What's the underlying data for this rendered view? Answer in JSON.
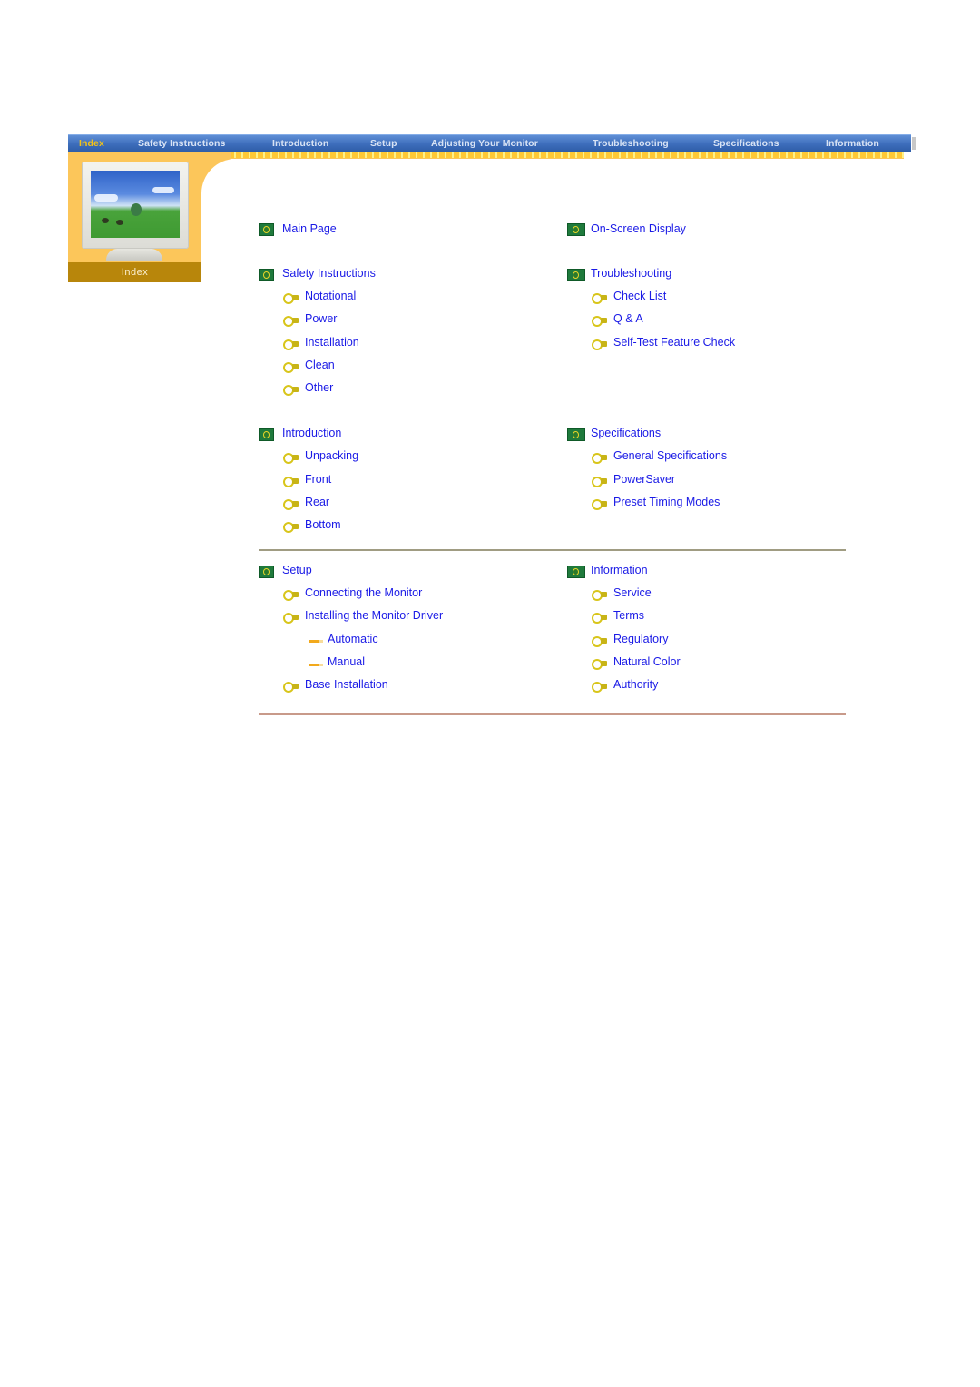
{
  "nav": {
    "items": [
      {
        "label": "Index",
        "active": true
      },
      {
        "label": "Safety Instructions",
        "active": false
      },
      {
        "label": "Introduction",
        "active": false
      },
      {
        "label": "Setup",
        "active": false
      },
      {
        "label": "Adjusting Your Monitor",
        "active": false
      },
      {
        "label": "Troubleshooting",
        "active": false
      },
      {
        "label": "Specifications",
        "active": false
      },
      {
        "label": "Information",
        "active": false
      }
    ]
  },
  "thumbnail": {
    "label": "Index",
    "icon": "monitor-image"
  },
  "colors": {
    "nav_bar": "#3d6dbb",
    "nav_active": "#f3c318",
    "accent_orange": "#fcc65a",
    "label_bar": "#b8860b",
    "link": "#1a1ae6"
  },
  "index": {
    "left": {
      "main_page": "Main Page",
      "safety": {
        "title": "Safety Instructions",
        "items": [
          "Notational",
          "Power",
          "Installation",
          "Clean",
          "Other"
        ]
      },
      "introduction": {
        "title": "Introduction",
        "items": [
          "Unpacking",
          "Front",
          "Rear",
          "Bottom"
        ]
      },
      "setup": {
        "title": "Setup",
        "items": [
          "Connecting the Monitor",
          "Installing the Monitor Driver",
          "Base Installation"
        ],
        "driver_subitems": [
          "Automatic",
          "Manual"
        ]
      }
    },
    "right": {
      "osd": "On-Screen Display",
      "troubleshooting": {
        "title": "Troubleshooting",
        "items": [
          "Check List",
          "Q & A",
          "Self-Test Feature Check"
        ]
      },
      "specifications": {
        "title": "Specifications",
        "items": [
          "General Specifications",
          "PowerSaver",
          "Preset Timing Modes"
        ]
      },
      "information": {
        "title": "Information",
        "items": [
          "Service",
          "Terms",
          "Regulatory",
          "Natural Color",
          "Authority"
        ]
      }
    }
  }
}
